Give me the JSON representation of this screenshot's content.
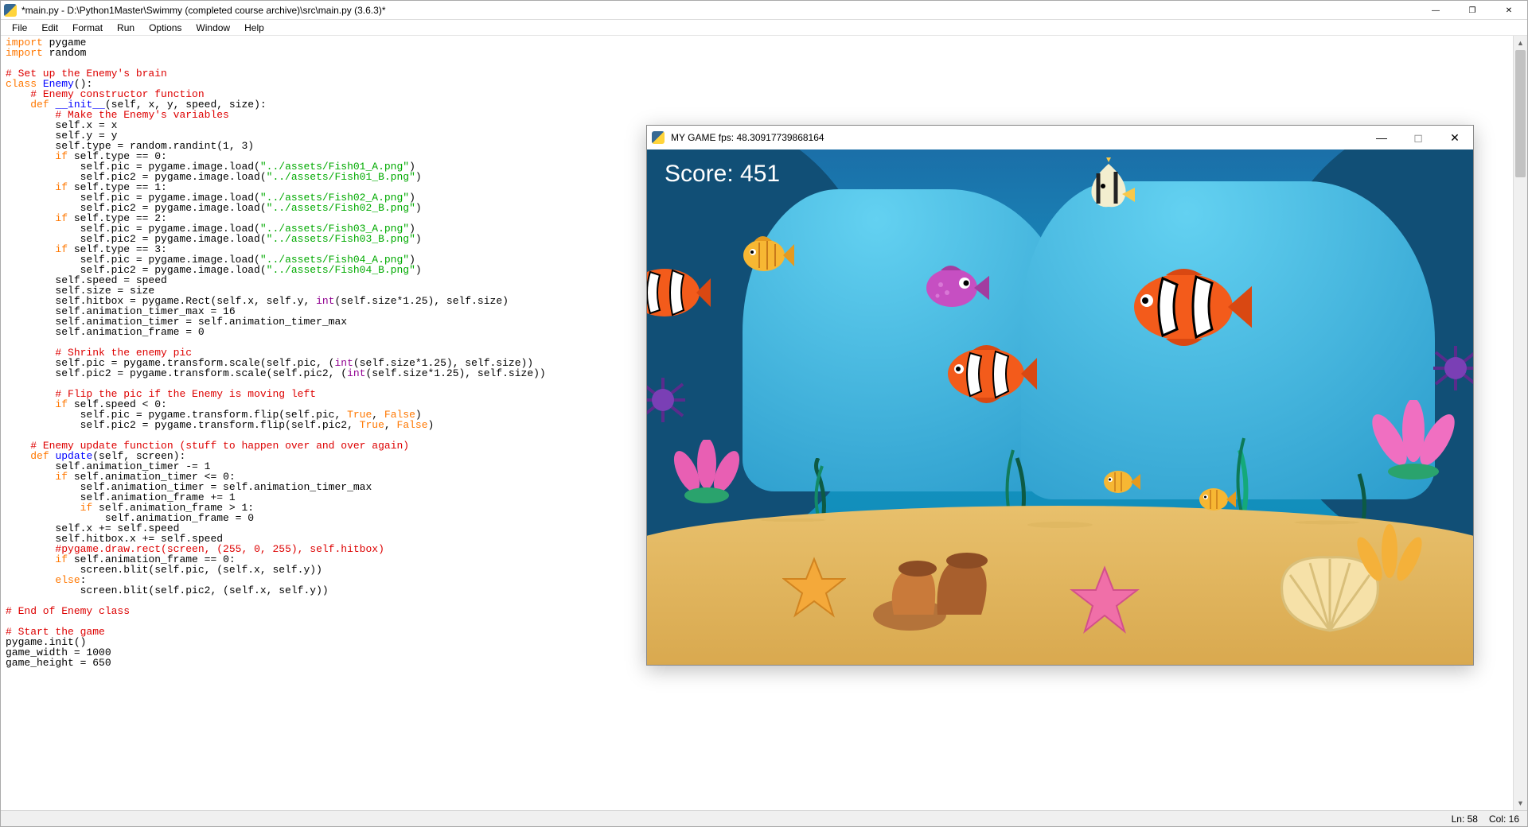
{
  "idle": {
    "title": "*main.py - D:\\Python1Master\\Swimmy (completed course archive)\\src\\main.py (3.6.3)*",
    "menu": [
      "File",
      "Edit",
      "Format",
      "Run",
      "Options",
      "Window",
      "Help"
    ],
    "status": {
      "ln": "Ln: 58",
      "col": "Col: 16"
    },
    "code_lines": [
      {
        "t": "import",
        "c": "kw"
      },
      {
        "t": " pygame\n"
      },
      {
        "t": "import",
        "c": "kw"
      },
      {
        "t": " random\n\n"
      },
      {
        "t": "# Set up the Enemy's brain\n",
        "c": "cm"
      },
      {
        "t": "class",
        "c": "kw"
      },
      {
        "t": " "
      },
      {
        "t": "Enemy",
        "c": "df"
      },
      {
        "t": "():\n"
      },
      {
        "t": "    "
      },
      {
        "t": "# Enemy constructor function\n",
        "c": "cm"
      },
      {
        "t": "    "
      },
      {
        "t": "def",
        "c": "kw"
      },
      {
        "t": " "
      },
      {
        "t": "__init__",
        "c": "df"
      },
      {
        "t": "(self, x, y, speed, size):\n"
      },
      {
        "t": "        "
      },
      {
        "t": "# Make the Enemy's variables\n",
        "c": "cm"
      },
      {
        "t": "        self.x = x\n"
      },
      {
        "t": "        self.y = y\n"
      },
      {
        "t": "        self.type = random.randint("
      },
      {
        "t": "1",
        "c": ""
      },
      {
        "t": ", "
      },
      {
        "t": "3",
        "c": ""
      },
      {
        "t": ")\n"
      },
      {
        "t": "        "
      },
      {
        "t": "if",
        "c": "kw"
      },
      {
        "t": " self.type == "
      },
      {
        "t": "0",
        "c": ""
      },
      {
        "t": ":\n"
      },
      {
        "t": "            self.pic = pygame.image.load("
      },
      {
        "t": "\"../assets/Fish01_A.png\"",
        "c": "str"
      },
      {
        "t": ")\n"
      },
      {
        "t": "            self.pic2 = pygame.image.load("
      },
      {
        "t": "\"../assets/Fish01_B.png\"",
        "c": "str"
      },
      {
        "t": ")\n"
      },
      {
        "t": "        "
      },
      {
        "t": "if",
        "c": "kw"
      },
      {
        "t": " self.type == "
      },
      {
        "t": "1",
        "c": ""
      },
      {
        "t": ":\n"
      },
      {
        "t": "            self.pic = pygame.image.load("
      },
      {
        "t": "\"../assets/Fish02_A.png\"",
        "c": "str"
      },
      {
        "t": ")\n"
      },
      {
        "t": "            self.pic2 = pygame.image.load("
      },
      {
        "t": "\"../assets/Fish02_B.png\"",
        "c": "str"
      },
      {
        "t": ")\n"
      },
      {
        "t": "        "
      },
      {
        "t": "if",
        "c": "kw"
      },
      {
        "t": " self.type == "
      },
      {
        "t": "2",
        "c": ""
      },
      {
        "t": ":\n"
      },
      {
        "t": "            self.pic = pygame.image.load("
      },
      {
        "t": "\"../assets/Fish03_A.png\"",
        "c": "str"
      },
      {
        "t": ")\n"
      },
      {
        "t": "            self.pic2 = pygame.image.load("
      },
      {
        "t": "\"../assets/Fish03_B.png\"",
        "c": "str"
      },
      {
        "t": ")\n"
      },
      {
        "t": "        "
      },
      {
        "t": "if",
        "c": "kw"
      },
      {
        "t": " self.type == "
      },
      {
        "t": "3",
        "c": ""
      },
      {
        "t": ":\n"
      },
      {
        "t": "            self.pic = pygame.image.load("
      },
      {
        "t": "\"../assets/Fish04_A.png\"",
        "c": "str"
      },
      {
        "t": ")\n"
      },
      {
        "t": "            self.pic2 = pygame.image.load("
      },
      {
        "t": "\"../assets/Fish04_B.png\"",
        "c": "str"
      },
      {
        "t": ")\n"
      },
      {
        "t": "        self.speed = speed\n"
      },
      {
        "t": "        self.size = size\n"
      },
      {
        "t": "        self.hitbox = pygame.Rect(self.x, self.y, "
      },
      {
        "t": "int",
        "c": "bn"
      },
      {
        "t": "(self.size*"
      },
      {
        "t": "1.25",
        "c": ""
      },
      {
        "t": "), self.size)\n"
      },
      {
        "t": "        self.animation_timer_max = "
      },
      {
        "t": "16",
        "c": ""
      },
      {
        "t": "\n"
      },
      {
        "t": "        self.animation_timer = self.animation_timer_max\n"
      },
      {
        "t": "        self.animation_frame = "
      },
      {
        "t": "0",
        "c": ""
      },
      {
        "t": "\n\n"
      },
      {
        "t": "        "
      },
      {
        "t": "# Shrink the enemy pic\n",
        "c": "cm"
      },
      {
        "t": "        self.pic = pygame.transform.scale(self.pic, ("
      },
      {
        "t": "int",
        "c": "bn"
      },
      {
        "t": "(self.size*"
      },
      {
        "t": "1.25",
        "c": ""
      },
      {
        "t": "), self.size))\n"
      },
      {
        "t": "        self.pic2 = pygame.transform.scale(self.pic2, ("
      },
      {
        "t": "int",
        "c": "bn"
      },
      {
        "t": "(self.size*"
      },
      {
        "t": "1.25",
        "c": ""
      },
      {
        "t": "), self.size))\n\n"
      },
      {
        "t": "        "
      },
      {
        "t": "# Flip the pic if the Enemy is moving left\n",
        "c": "cm"
      },
      {
        "t": "        "
      },
      {
        "t": "if",
        "c": "kw"
      },
      {
        "t": " self.speed < "
      },
      {
        "t": "0",
        "c": ""
      },
      {
        "t": ":\n"
      },
      {
        "t": "            self.pic = pygame.transform.flip(self.pic, "
      },
      {
        "t": "True",
        "c": "kw"
      },
      {
        "t": ", "
      },
      {
        "t": "False",
        "c": "kw"
      },
      {
        "t": ")\n"
      },
      {
        "t": "            self.pic2 = pygame.transform.flip(self.pic2, "
      },
      {
        "t": "True",
        "c": "kw"
      },
      {
        "t": ", "
      },
      {
        "t": "False",
        "c": "kw"
      },
      {
        "t": ")\n\n"
      },
      {
        "t": "    "
      },
      {
        "t": "# Enemy update function (stuff to happen over and over again)\n",
        "c": "cm"
      },
      {
        "t": "    "
      },
      {
        "t": "def",
        "c": "kw"
      },
      {
        "t": " "
      },
      {
        "t": "update",
        "c": "df"
      },
      {
        "t": "(self, screen):\n"
      },
      {
        "t": "        self.animation_timer -= "
      },
      {
        "t": "1",
        "c": ""
      },
      {
        "t": "\n"
      },
      {
        "t": "        "
      },
      {
        "t": "if",
        "c": "kw"
      },
      {
        "t": " self.animation_timer <= "
      },
      {
        "t": "0",
        "c": ""
      },
      {
        "t": ":\n"
      },
      {
        "t": "            self.animation_timer = self.animation_timer_max\n"
      },
      {
        "t": "            self.animation_frame += "
      },
      {
        "t": "1",
        "c": ""
      },
      {
        "t": "\n"
      },
      {
        "t": "            "
      },
      {
        "t": "if",
        "c": "kw"
      },
      {
        "t": " self.animation_frame > "
      },
      {
        "t": "1",
        "c": ""
      },
      {
        "t": ":\n"
      },
      {
        "t": "                self.animation_frame = "
      },
      {
        "t": "0",
        "c": ""
      },
      {
        "t": "\n"
      },
      {
        "t": "        self.x += self.speed\n"
      },
      {
        "t": "        self.hitbox.x += self.speed\n"
      },
      {
        "t": "        "
      },
      {
        "t": "#pygame.draw.rect(screen, (255, 0, 255), self.hitbox)\n",
        "c": "cm"
      },
      {
        "t": "        "
      },
      {
        "t": "if",
        "c": "kw"
      },
      {
        "t": " self.animation_frame == "
      },
      {
        "t": "0",
        "c": ""
      },
      {
        "t": ":\n"
      },
      {
        "t": "            screen.blit(self.pic, (self.x, self.y))\n"
      },
      {
        "t": "        "
      },
      {
        "t": "else",
        "c": "kw"
      },
      {
        "t": ":\n"
      },
      {
        "t": "            screen.blit(self.pic2, (self.x, self.y))\n\n"
      },
      {
        "t": "# End of Enemy class\n",
        "c": "cm"
      },
      {
        "t": "\n"
      },
      {
        "t": "# Start the game\n",
        "c": "cm"
      },
      {
        "t": "pygame.init()\n"
      },
      {
        "t": "game_width = "
      },
      {
        "t": "1000",
        "c": ""
      },
      {
        "t": "\n"
      },
      {
        "t": "game_height = "
      },
      {
        "t": "650",
        "c": ""
      },
      {
        "t": "\n"
      }
    ]
  },
  "game": {
    "title": "MY GAME fps: 48.30917739868164",
    "score_label": "Score: 451"
  }
}
